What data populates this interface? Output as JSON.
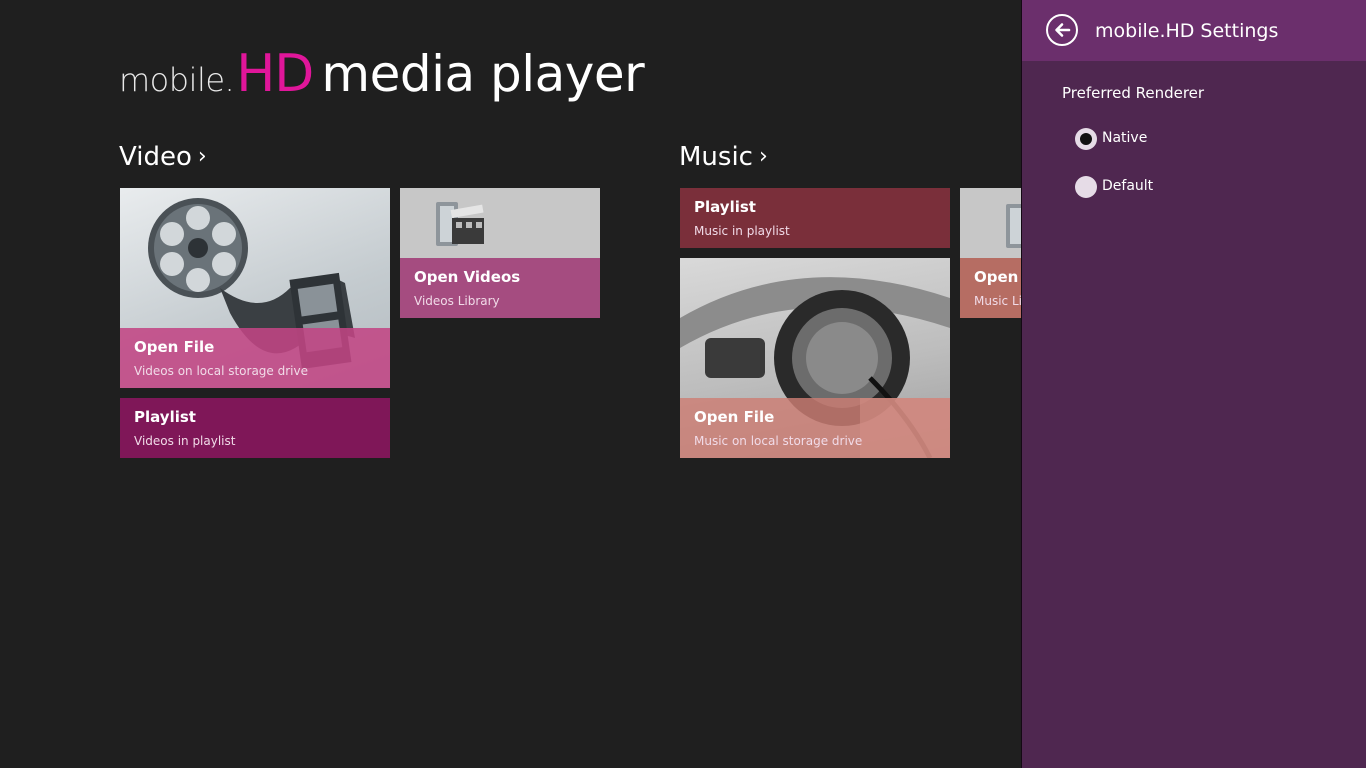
{
  "app": {
    "title_part1": "mobile.",
    "title_part2": "HD",
    "title_part3": "media player"
  },
  "video_section": {
    "heading": "Video",
    "tiles": [
      {
        "title": "Open File",
        "subtitle": "Videos on local storage drive"
      },
      {
        "title": "Open Videos",
        "subtitle": "Videos Library"
      },
      {
        "title": "Playlist",
        "subtitle": "Videos in playlist"
      }
    ]
  },
  "music_section": {
    "heading": "Music",
    "tiles": [
      {
        "title": "Playlist",
        "subtitle": "Music in playlist"
      },
      {
        "title": "Open File",
        "subtitle": "Music on local storage drive"
      },
      {
        "title": "Open Music",
        "subtitle": "Music Library"
      }
    ]
  },
  "settings": {
    "title": "mobile.HD Settings",
    "renderer_label": "Preferred Renderer",
    "options": [
      {
        "label": "Native",
        "selected": true
      },
      {
        "label": "Default",
        "selected": false
      }
    ]
  },
  "colors": {
    "accent_hd": "#e0169a",
    "settings_bg": "#4f2750",
    "settings_header": "#6b2f6c",
    "video_playlist_tile": "#7f1758",
    "music_playlist_tile": "#7a2f3a"
  },
  "icons": [
    "film-reel-icon",
    "video-library-icon",
    "headphones-icon",
    "back-arrow-icon",
    "chevron-right-icon"
  ]
}
